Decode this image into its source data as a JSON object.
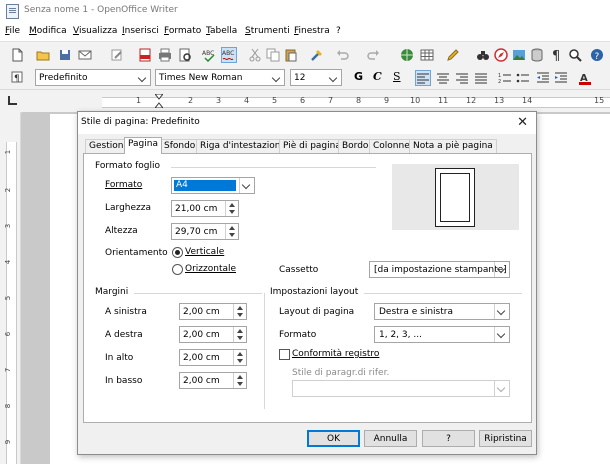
{
  "window": {
    "title": "Senza nome 1 - OpenOffice Writer"
  },
  "menu": [
    "File",
    "Modifica",
    "Visualizza",
    "Inserisci",
    "Formato",
    "Tabella",
    "Strumenti",
    "Finestra",
    "?"
  ],
  "format_bar": {
    "style": "Predefinito",
    "font": "Times New Roman",
    "size": "12",
    "bold": "G",
    "italic": "C",
    "underline": "S"
  },
  "ruler": {
    "numbers": [
      "1",
      "2",
      "3",
      "4",
      "5",
      "6",
      "7",
      "8",
      "9",
      "10",
      "11",
      "12",
      "13",
      "14",
      "15"
    ]
  },
  "vruler": {
    "numbers": [
      "1",
      "2",
      "3",
      "4",
      "5",
      "6",
      "7",
      "8",
      "9"
    ]
  },
  "dialog": {
    "title": "Stile di pagina: Predefinito",
    "tabs": [
      "Gestione",
      "Pagina",
      "Sfondo",
      "Riga d'intestazione",
      "Piè di pagina",
      "Bordo",
      "Colonne",
      "Nota a piè pagina"
    ],
    "formato_foglio": {
      "section": "Formato foglio",
      "formato_label": "Formato",
      "formato_value": "A4",
      "larghezza_label": "Larghezza",
      "larghezza_value": "21,00 cm",
      "altezza_label": "Altezza",
      "altezza_value": "29,70 cm",
      "orientamento_label": "Orientamento",
      "verticale": "Verticale",
      "orizzontale": "Orizzontale",
      "cassetto_label": "Cassetto",
      "cassetto_value": "[da impostazione stampante]"
    },
    "margini": {
      "section": "Margini",
      "sinistra_label": "A sinistra",
      "sinistra_value": "2,00 cm",
      "destra_label": "A destra",
      "destra_value": "2,00 cm",
      "alto_label": "In alto",
      "alto_value": "2,00 cm",
      "basso_label": "In basso",
      "basso_value": "2,00 cm"
    },
    "impostazioni": {
      "section": "Impostazioni layout",
      "layout_label": "Layout di pagina",
      "layout_value": "Destra e sinistra",
      "formato_label": "Formato",
      "formato_value": "1, 2, 3, ...",
      "conformita": "Conformità registro",
      "stile_label": "Stile di paragr.di rifer.",
      "stile_value": ""
    },
    "buttons": {
      "ok": "OK",
      "annulla": "Annulla",
      "help": "?",
      "ripristina": "Ripristina"
    }
  }
}
